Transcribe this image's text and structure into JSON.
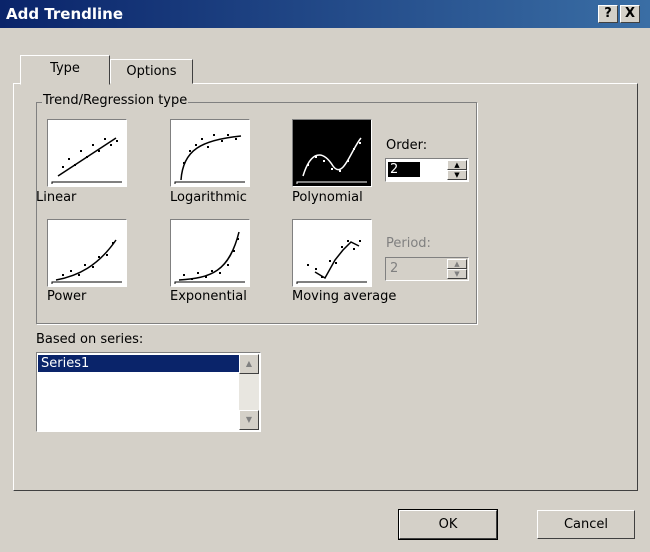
{
  "window": {
    "title": "Add Trendline",
    "help_glyph": "?",
    "close_glyph": "X"
  },
  "tabs": [
    {
      "label": "Type"
    },
    {
      "label": "Options"
    }
  ],
  "group": {
    "label": "Trend/Regression type"
  },
  "trend_types": [
    {
      "label": "Linear",
      "mnemonic": "L",
      "icon": "linear-trend-icon",
      "selected": false
    },
    {
      "label": "Logarithmic",
      "mnemonic": "o",
      "icon": "logarithmic-trend-icon",
      "selected": false
    },
    {
      "label": "Polynomial",
      "mnemonic": "P",
      "icon": "polynomial-trend-icon",
      "selected": true
    },
    {
      "label": "Power",
      "mnemonic": "w",
      "icon": "power-trend-icon",
      "selected": false
    },
    {
      "label": "Exponential",
      "mnemonic": "x",
      "icon": "exponential-trend-icon",
      "selected": false
    },
    {
      "label": "Moving average",
      "mnemonic": "M",
      "icon": "moving-average-trend-icon",
      "selected": false
    }
  ],
  "order": {
    "label": "Order:",
    "value": "2",
    "enabled": true
  },
  "period": {
    "label": "Period:",
    "value": "2",
    "enabled": false
  },
  "series": {
    "label": "Based on series:",
    "items": [
      "Series1"
    ],
    "selected": "Series1"
  },
  "buttons": {
    "ok": "OK",
    "cancel": "Cancel"
  },
  "colors": {
    "title_bar": "#0a246a",
    "dialog_bg": "#d4d0c8",
    "selection": "#0a246a",
    "disabled_text": "#808080"
  }
}
